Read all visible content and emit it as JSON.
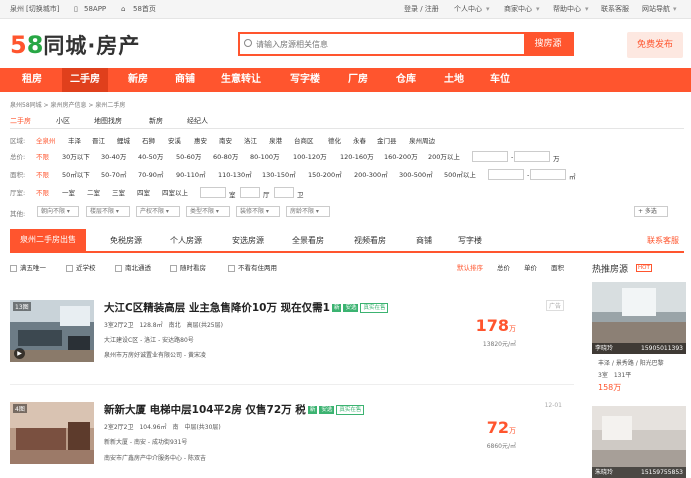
{
  "topbar": {
    "city": "泉州",
    "switch_city": "[切换城市]",
    "app": "58APP",
    "home": "58首页",
    "login": "登录 / 注册",
    "personal": "个人中心",
    "merchant": "商家中心",
    "help": "帮助中心",
    "service": "联系客服",
    "sitenav": "网站导航"
  },
  "logo": {
    "n5": "5",
    "n8": "8",
    "text": "同城·房产"
  },
  "search": {
    "placeholder": "请输入房源相关信息",
    "button": "搜房源"
  },
  "free_publish": "免费发布",
  "nav": [
    "租房",
    "二手房",
    "新房",
    "商铺",
    "生意转让",
    "写字楼",
    "厂房",
    "仓库",
    "土地",
    "车位"
  ],
  "breadcrumb": "泉州58同城 > 泉州房产信息 > 泉州二手房",
  "subtabs": [
    "二手房",
    "小区",
    "地图找房",
    "新房",
    "经纪人"
  ],
  "filters": {
    "area_label": "区域:",
    "area": [
      "全泉州",
      "丰泽",
      "晋江",
      "鲤城",
      "石狮",
      "安溪",
      "惠安",
      "南安",
      "洛江",
      "泉港",
      "台商区",
      "德化",
      "永春",
      "金门县",
      "泉州周边"
    ],
    "price_label": "总价:",
    "price": [
      "不限",
      "30万以下",
      "30-40万",
      "40-50万",
      "50-60万",
      "60-80万",
      "80-100万",
      "100-120万",
      "120-160万",
      "160-200万",
      "200万以上"
    ],
    "price_unit": "万",
    "size_label": "面积:",
    "size": [
      "不限",
      "50㎡以下",
      "50-70㎡",
      "70-90㎡",
      "90-110㎡",
      "110-130㎡",
      "130-150㎡",
      "150-200㎡",
      "200-300㎡",
      "300-500㎡",
      "500㎡以上"
    ],
    "size_unit": "㎡",
    "room_label": "厅室:",
    "room": [
      "不限",
      "一室",
      "二室",
      "三室",
      "四室",
      "四室以上"
    ],
    "room_inputs": [
      "室",
      "厅",
      "卫"
    ],
    "other_label": "其他:",
    "other": [
      "朝向不限",
      "楼层不限",
      "产权不限",
      "类型不限",
      "装修不限",
      "房龄不限"
    ],
    "more": "+ 多选"
  },
  "tabs": [
    "泉州二手房出售",
    "免税房源",
    "个人房源",
    "安选房源",
    "全景看房",
    "视频看房",
    "商铺",
    "写字楼"
  ],
  "contact": "联系客服",
  "sortbar": {
    "checks": [
      "满五唯一",
      "近学校",
      "南北通透",
      "随时看房",
      "不看有住两用"
    ],
    "sorts": [
      "默认排序",
      "总价",
      "单价",
      "面积"
    ]
  },
  "listings": [
    {
      "photos": "13图",
      "title": "大江C区精装高层 业主急售降价10万 现在仅需1",
      "badge1": "新",
      "badge2": "安选",
      "badge3": "真实在售",
      "detail": "3室2厅2卫　128.8㎡　南北　高层(共25层)",
      "location": "大江建设C区 - 洛江 - 安达路80号",
      "agent": "泉州市万房好诚置业有限公司 - 黄宋凌",
      "price": "178",
      "price_unit": "万",
      "unit_price": "13820元/㎡",
      "tag": "广告"
    },
    {
      "photos": "4图",
      "title": "新新大厦 电梯中层104平2房 仅售72万 税",
      "badge1": "新",
      "badge2": "安选",
      "badge3": "真实在售",
      "detail": "2室2厅2卫　104.96㎡　南　中层(共30层)",
      "location": "新新大厦 - 南安 - 成功街931号",
      "agent": "南安市广鑫房产中介服务中心 - 陈双吉",
      "price": "72",
      "price_unit": "万",
      "unit_price": "6860元/㎡",
      "tag": "12-01"
    }
  ],
  "side": {
    "title": "热推房源",
    "hot": "HOT",
    "items": [
      {
        "name": "李晓玲",
        "phone": "15905011393",
        "line1": "丰泽 / 景秀路 / 阳光巴黎",
        "line2": "3室　131平",
        "price": "158万"
      },
      {
        "name": "朱晓玲",
        "phone": "15159755853"
      }
    ]
  }
}
